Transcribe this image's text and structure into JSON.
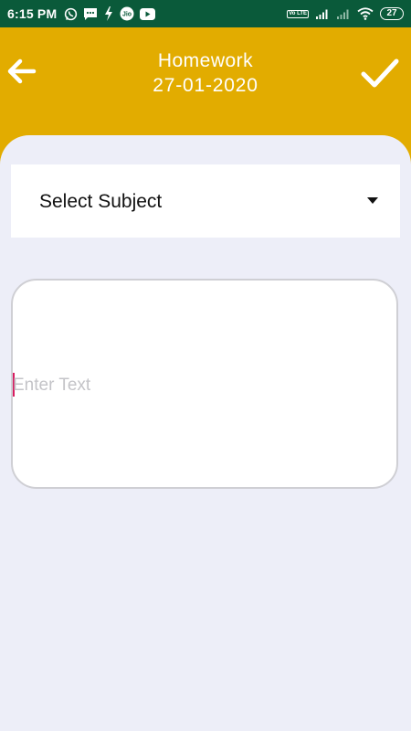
{
  "status_bar": {
    "time": "6:15 PM",
    "left_icons": [
      "whatsapp-icon",
      "message-icon",
      "flash-icon",
      "jio-icon",
      "youtube-icon"
    ],
    "volte_label": "Vo LTE",
    "battery": "27",
    "background_color": "#0a5a3a"
  },
  "header": {
    "title": "Homework",
    "date": "27-01-2020",
    "back_icon": "arrow-left-icon",
    "confirm_icon": "checkmark-icon",
    "background_color": "#e2ac00"
  },
  "form": {
    "subject_select": {
      "value": "Select Subject",
      "icon": "chevron-down-icon"
    },
    "text_input": {
      "value": "",
      "placeholder": "Enter Text",
      "caret_color": "#d81b60"
    },
    "background_color": "#edeef8"
  }
}
